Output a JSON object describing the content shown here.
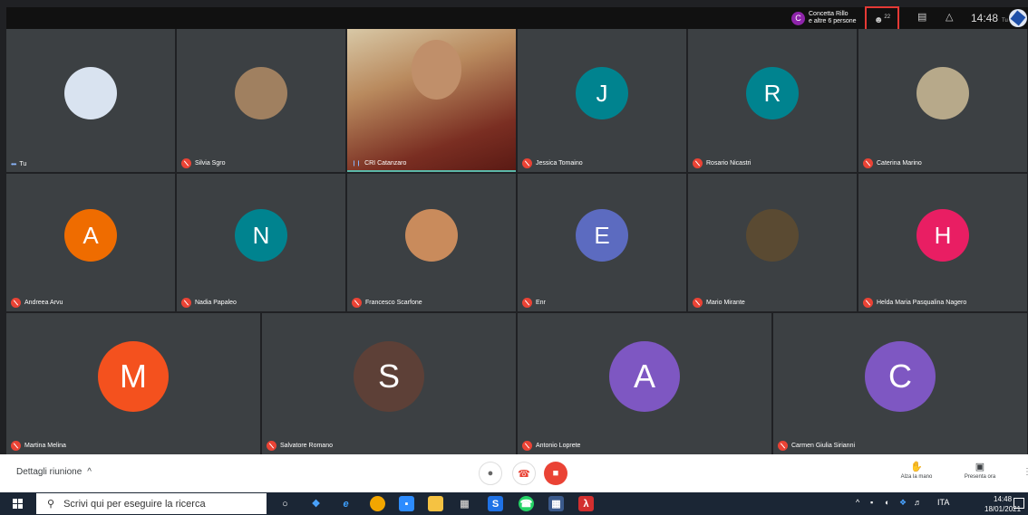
{
  "topbar": {
    "presenter_initial": "C",
    "presenter_line1": "Concetta Rillo",
    "presenter_line2": "e altre 6 persone",
    "people_count": "22",
    "time": "14:48",
    "self_label": "Tu"
  },
  "tiles": [
    {
      "name": "Tu",
      "status": "dots",
      "avatar": "photo",
      "color": "#d9e3f0"
    },
    {
      "name": "Silvia Sgro",
      "status": "muted",
      "avatar": "photo",
      "color": "#a08060"
    },
    {
      "name": "CRI Catanzaro",
      "status": "speaking",
      "avatar": "video",
      "color": "#6b3a2a"
    },
    {
      "name": "Jessica Tomaino",
      "status": "muted",
      "initial": "J",
      "color": "#00838f"
    },
    {
      "name": "Rosario Nicastri",
      "status": "muted",
      "initial": "R",
      "color": "#00838f"
    },
    {
      "name": "Caterina Marino",
      "status": "muted",
      "avatar": "photo",
      "color": "#b7a98a"
    },
    {
      "name": "Andreea Arvu",
      "status": "muted",
      "initial": "A",
      "color": "#ef6c00"
    },
    {
      "name": "Nadia Papaleo",
      "status": "muted",
      "initial": "N",
      "color": "#00838f"
    },
    {
      "name": "Francesco Scarfone",
      "status": "muted",
      "avatar": "photo",
      "color": "#c98b5c"
    },
    {
      "name": "Enr",
      "status": "muted",
      "initial": "E",
      "color": "#5c6bc0"
    },
    {
      "name": "Mario Mirante",
      "status": "muted",
      "avatar": "photo",
      "color": "#5a4a32"
    },
    {
      "name": "Helda Maria Pasqualina Nagero",
      "status": "muted",
      "initial": "H",
      "color": "#e91e63"
    },
    {
      "name": "Martina Melina",
      "status": "muted",
      "initial": "M",
      "color": "#f4511e"
    },
    {
      "name": "Salvatore Romano",
      "status": "muted",
      "initial": "S",
      "color": "#5d4037"
    },
    {
      "name": "Antonio Loprete",
      "status": "muted",
      "initial": "A",
      "color": "#7e57c2"
    },
    {
      "name": "Carmen Giulia Sirianni",
      "status": "muted",
      "initial": "C",
      "color": "#7e57c2"
    }
  ],
  "controls": {
    "details_label": "Dettagli riunione",
    "details_chevron": "^",
    "raise_hand_label": "Alza la mano",
    "present_label": "Presenta ora",
    "mic_icon": "mic-icon",
    "hangup_icon": "hangup-icon",
    "camera_off_icon": "camera-off-icon"
  },
  "taskbar": {
    "search_placeholder": "Scrivi qui per eseguire la ricerca",
    "lang": "ITA",
    "clock_time": "14:48",
    "clock_date": "18/01/2021"
  }
}
